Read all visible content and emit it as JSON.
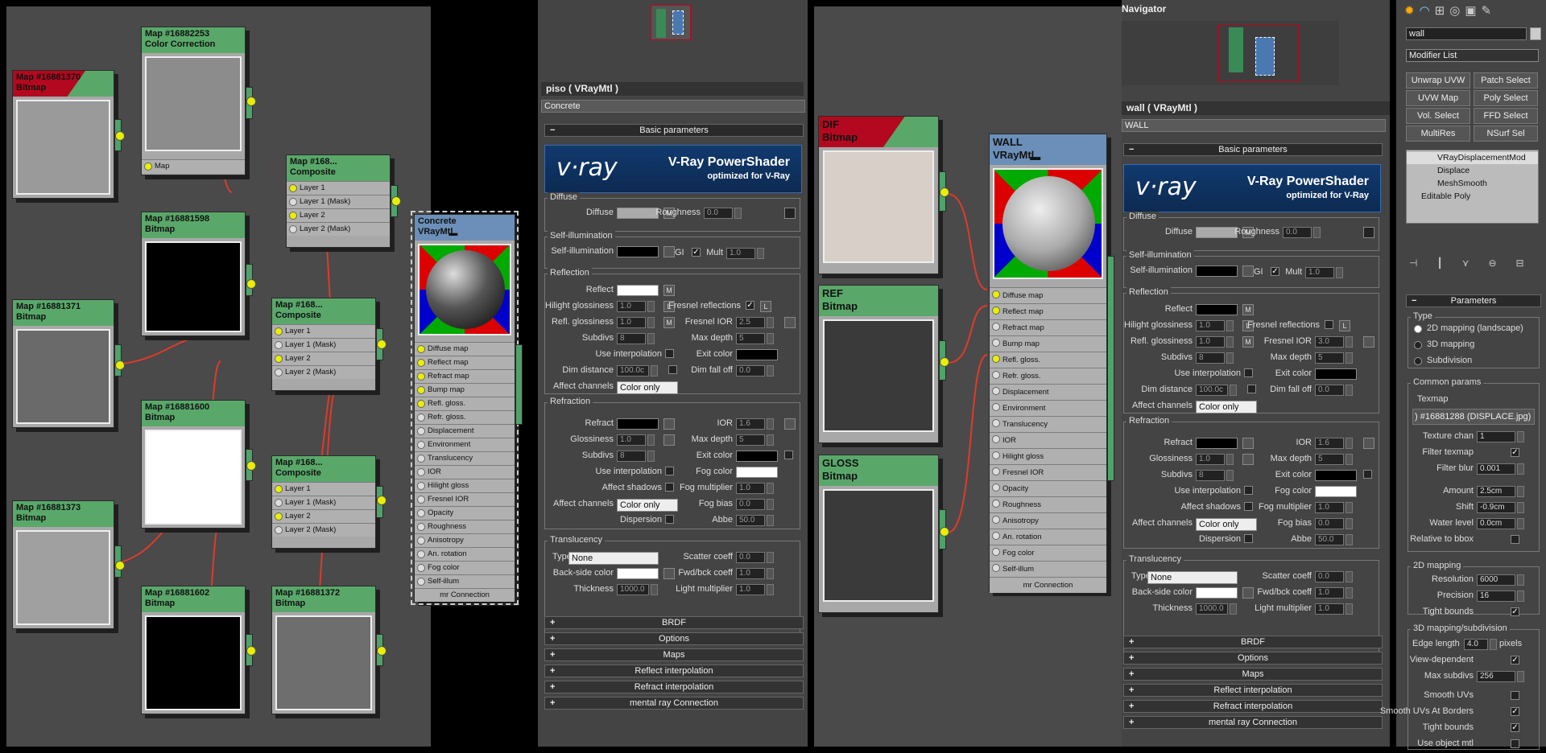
{
  "left_graph": {
    "nodes": {
      "m370": {
        "title": "Map #16881370",
        "type": "Bitmap"
      },
      "m253": {
        "title": "Map #16882253",
        "type": "Color Correction",
        "slot": "Map"
      },
      "m598": {
        "title": "Map #16881598",
        "type": "Bitmap"
      },
      "m371": {
        "title": "Map #16881371",
        "type": "Bitmap"
      },
      "m600": {
        "title": "Map #16881600",
        "type": "Bitmap"
      },
      "m373": {
        "title": "Map #16881373",
        "type": "Bitmap"
      },
      "m602": {
        "title": "Map #16881602",
        "type": "Bitmap"
      },
      "m372": {
        "title": "Map #16881372",
        "type": "Bitmap"
      },
      "comp": {
        "title": "Map #168...",
        "type": "Composite",
        "layers": [
          "Layer 1",
          "Layer 1 (Mask)",
          "Layer 2",
          "Layer 2 (Mask)"
        ]
      },
      "concrete": {
        "title": "Concrete",
        "type": "VRayMtl"
      }
    }
  },
  "material_slots": [
    "Diffuse map",
    "Reflect map",
    "Refract map",
    "Bump map",
    "Refl. gloss.",
    "Refr. gloss.",
    "Displacement",
    "Environment",
    "Translucency",
    "IOR",
    "Hilight gloss",
    "Fresnel IOR",
    "Opacity",
    "Roughness",
    "Anisotropy",
    "An. rotation",
    "Fog color",
    "Self-illum"
  ],
  "mr_connection": "mr Connection",
  "piso": {
    "title": "piso  ( VRayMtl )",
    "name": "Concrete"
  },
  "wall_panel": {
    "title": "wall  ( VRayMtl )",
    "name": "WALL",
    "navigator": "Navigator"
  },
  "right_graph": {
    "dif": {
      "title": "DIF",
      "type": "Bitmap"
    },
    "ref": {
      "title": "REF",
      "type": "Bitmap"
    },
    "gloss": {
      "title": "GLOSS",
      "type": "Bitmap"
    },
    "wall": {
      "title": "WALL",
      "type": "VRayMtl"
    }
  },
  "vray": {
    "logo": "v·ray",
    "line1": "V-Ray PowerShader",
    "line2": "optimized for V-Ray"
  },
  "basic": {
    "header": "Basic parameters",
    "diffuse": "Diffuse",
    "diffuse_lbl": "Diffuse",
    "roughness": "Roughness",
    "roughness_v": "0.0",
    "selfillum": "Self-illumination",
    "selfillum_lbl": "Self-illumination",
    "gi": "GI",
    "mult": "Mult",
    "mult_v": "1.0",
    "reflection": "Reflection",
    "reflect": "Reflect",
    "hilight": "Hilight glossiness",
    "hilight_v": "1.0",
    "fresnel": "Fresnel reflections",
    "reflgloss": "Refl. glossiness",
    "reflgloss_v": "1.0",
    "fresnel_ior": "Fresnel IOR",
    "fresnel_ior_v_piso": "2.5",
    "fresnel_ior_v_wall": "3.0",
    "subdivs": "Subdivs",
    "subdivs_v": "8",
    "maxdepth": "Max depth",
    "maxdepth_v": "5",
    "useinterp": "Use interpolation",
    "exitcolor": "Exit color",
    "dimdist": "Dim distance",
    "dimdist_v": "100.0c",
    "dimfall": "Dim fall off",
    "dimfall_v": "0.0",
    "affect": "Affect channels",
    "affect_v": "Color only",
    "refraction": "Refraction",
    "refract": "Refract",
    "ior": "IOR",
    "ior_v": "1.6",
    "glossiness": "Glossiness",
    "glossiness_v": "1.0",
    "fogcolor": "Fog color",
    "affectshadows": "Affect shadows",
    "fogmult": "Fog multiplier",
    "fogmult_v": "1.0",
    "fogbias": "Fog bias",
    "fogbias_v": "0.0",
    "dispersion": "Dispersion",
    "abbe": "Abbe",
    "abbe_v": "50.0",
    "translucency": "Translucency",
    "type": "Type",
    "type_v": "None",
    "scatter": "Scatter coeff",
    "scatter_v": "0.0",
    "backside": "Back-side color",
    "fwdbck": "Fwd/bck coeff",
    "fwdbck_v": "1.0",
    "thickness": "Thickness",
    "thickness_v": "1000.0",
    "light": "Light multiplier",
    "light_v": "1.0",
    "L": "L",
    "M": "M"
  },
  "rollouts": [
    "BRDF",
    "Options",
    "Maps",
    "Reflect interpolation",
    "Refract interpolation",
    "mental ray Connection"
  ],
  "cmd": {
    "search": "wall",
    "modlist": "Modifier List",
    "buttons": [
      "Unwrap UVW",
      "Patch Select",
      "UVW Map",
      "Poly Select",
      "Vol. Select",
      "FFD Select",
      "MultiRes",
      "NSurf Sel"
    ],
    "stack": [
      "VRayDisplacementMod",
      "Displace",
      "MeshSmooth",
      "Editable Poly"
    ],
    "params": "Parameters",
    "type": "Type",
    "types": [
      "2D mapping (landscape)",
      "3D mapping",
      "Subdivision"
    ],
    "common": "Common params",
    "texmap": "Texmap",
    "texmap_v": ") #16881288 (DISPLACE.jpg)",
    "texchan": "Texture chan",
    "texchan_v": "1",
    "filtertex": "Filter texmap",
    "filterblur": "Filter blur",
    "filterblur_v": "0.001",
    "amount": "Amount",
    "amount_v": "2.5cm",
    "shift": "Shift",
    "shift_v": "-0.9cm",
    "water": "Water level",
    "water_v": "0.0cm",
    "relbbox": "Relative to bbox",
    "map2d": "2D mapping",
    "resolution": "Resolution",
    "resolution_v": "6000",
    "precision": "Precision",
    "precision_v": "16",
    "tight": "Tight bounds",
    "map3d": "3D mapping/subdivision",
    "edge": "Edge length",
    "edge_v": "4.0",
    "pixels": "pixels",
    "viewdep": "View-dependent",
    "maxsub": "Max subdivs",
    "maxsub_v": "256",
    "smooth": "Smooth UVs",
    "smoothb": "Smooth UVs At Borders",
    "tight2": "Tight bounds",
    "useobj": "Use object mtl"
  }
}
